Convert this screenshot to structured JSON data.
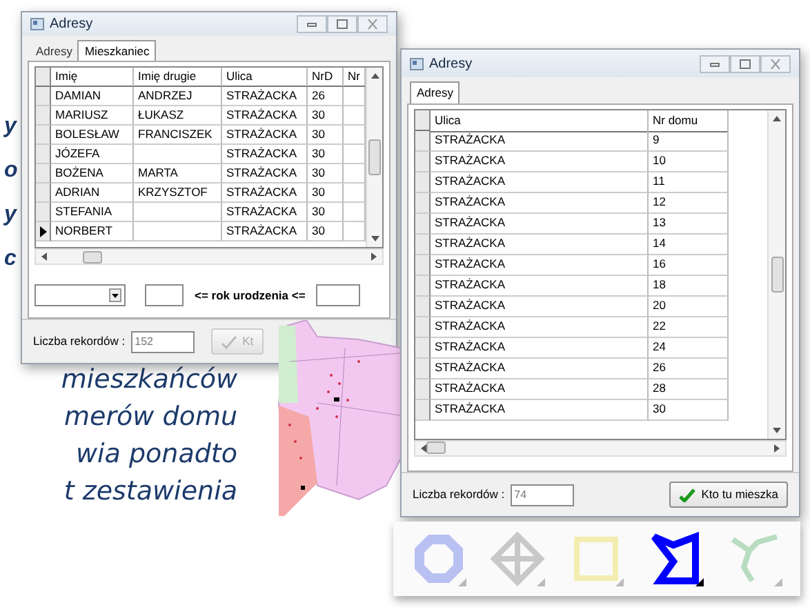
{
  "side_letters": [
    "y",
    "o",
    "y",
    "c"
  ],
  "paragraph_lines": [
    "mieszkańców",
    "merów domu",
    "wia ponadto",
    "t zestawienia"
  ],
  "windows": [
    {
      "title": "Adresy",
      "tabs": [
        {
          "label": "Adresy",
          "selected": false
        },
        {
          "label": "Mieszkaniec",
          "selected": true
        }
      ],
      "table": {
        "columns": [
          "Imię",
          "Imię drugie",
          "Ulica",
          "NrD",
          "Nr"
        ],
        "rows": [
          {
            "cells": [
              "DAMIAN",
              "ANDRZEJ",
              "STRAŻACKA",
              "26",
              ""
            ],
            "current": false
          },
          {
            "cells": [
              "MARIUSZ",
              "ŁUKASZ",
              "STRAŻACKA",
              "30",
              ""
            ],
            "current": false
          },
          {
            "cells": [
              "BOLESŁAW",
              "FRANCISZEK",
              "STRAŻACKA",
              "30",
              ""
            ],
            "current": false
          },
          {
            "cells": [
              "JÓZEFA",
              "",
              "STRAŻACKA",
              "30",
              ""
            ],
            "current": false
          },
          {
            "cells": [
              "BOŻENA",
              "MARTA",
              "STRAŻACKA",
              "30",
              ""
            ],
            "current": false
          },
          {
            "cells": [
              "ADRIAN",
              "KRZYSZTOF",
              "STRAŻACKA",
              "30",
              ""
            ],
            "current": false
          },
          {
            "cells": [
              "STEFANIA",
              "",
              "STRAŻACKA",
              "30",
              ""
            ],
            "current": false
          },
          {
            "cells": [
              "NORBERT",
              "",
              "STRAŻACKA",
              "30",
              ""
            ],
            "current": true
          }
        ]
      },
      "filters": {
        "range_label": "<= rok urodzenia <="
      },
      "record_label": "Liczba rekordów :",
      "record_count": "152",
      "button": {
        "label": "Kt",
        "disabled": true
      }
    },
    {
      "title": "Adresy",
      "tabs": [
        {
          "label": "Adresy",
          "selected": true
        }
      ],
      "table": {
        "columns": [
          "Ulica",
          "Nr domu"
        ],
        "rows": [
          {
            "cells": [
              "STRAŻACKA",
              "9"
            ],
            "current": false
          },
          {
            "cells": [
              "STRAŻACKA",
              "10"
            ],
            "current": false
          },
          {
            "cells": [
              "STRAŻACKA",
              "11"
            ],
            "current": false
          },
          {
            "cells": [
              "STRAŻACKA",
              "12"
            ],
            "current": false
          },
          {
            "cells": [
              "STRAŻACKA",
              "13"
            ],
            "current": false
          },
          {
            "cells": [
              "STRAŻACKA",
              "14"
            ],
            "current": false
          },
          {
            "cells": [
              "STRAŻACKA",
              "16"
            ],
            "current": false
          },
          {
            "cells": [
              "STRAŻACKA",
              "18"
            ],
            "current": false
          },
          {
            "cells": [
              "STRAŻACKA",
              "20"
            ],
            "current": false
          },
          {
            "cells": [
              "STRAŻACKA",
              "22"
            ],
            "current": false
          },
          {
            "cells": [
              "STRAŻACKA",
              "24"
            ],
            "current": false
          },
          {
            "cells": [
              "STRAŻACKA",
              "26"
            ],
            "current": false
          },
          {
            "cells": [
              "STRAŻACKA",
              "28"
            ],
            "current": false
          },
          {
            "cells": [
              "STRAŻACKA",
              "30"
            ],
            "current": false
          }
        ]
      },
      "record_label": "Liczba rekordów :",
      "record_count": "74",
      "button": {
        "label": "Kto tu mieszka",
        "disabled": false
      }
    }
  ],
  "toolbar": {
    "tools": [
      {
        "kind": "octagon",
        "color": "#b9c0f2",
        "selected": false
      },
      {
        "kind": "crosshair",
        "color": "#c8c8c8",
        "selected": false
      },
      {
        "kind": "square",
        "color": "#f3eeb0",
        "selected": false
      },
      {
        "kind": "polygon",
        "color": "#0000ff",
        "selected": true
      },
      {
        "kind": "polyline",
        "color": "#b8dcc0",
        "selected": false
      }
    ]
  }
}
